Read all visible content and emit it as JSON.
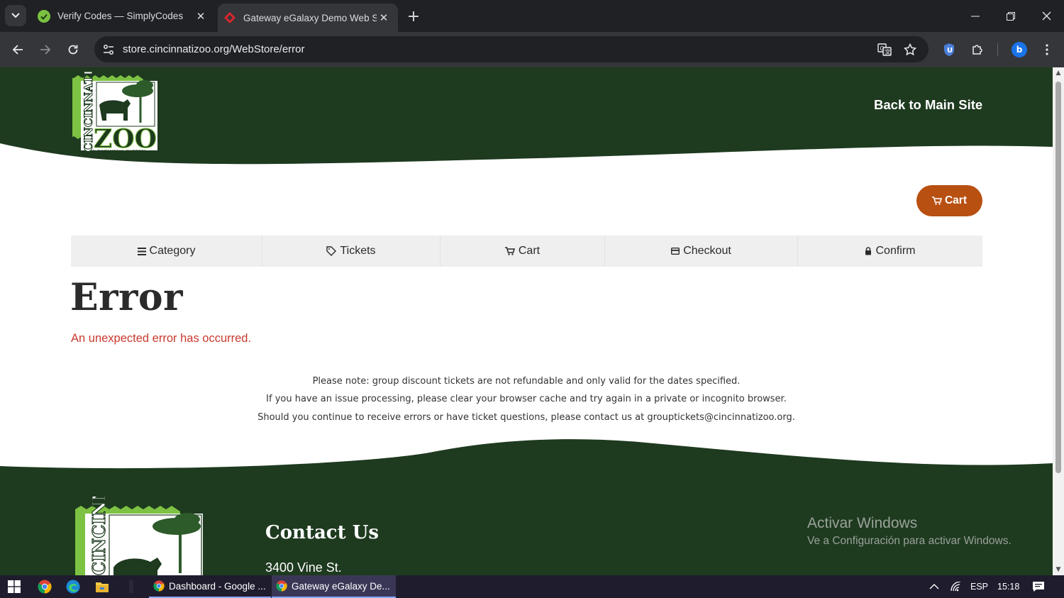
{
  "browser": {
    "tabs": [
      {
        "title": "Verify Codes — SimplyCodes",
        "active": false
      },
      {
        "title": "Gateway eGalaxy Demo Web St",
        "active": true
      }
    ],
    "url": "store.cincinnatizoo.org/WebStore/error",
    "profile_initial": "b",
    "colors": {
      "frame": "#202124",
      "toolbar": "#35363a"
    }
  },
  "header": {
    "back_link": "Back to Main Site",
    "logo_text": "CINCINNATI ZOO & BOTANICAL GARDEN"
  },
  "cart_button": {
    "label": "Cart",
    "icon": "cart-icon"
  },
  "steps": [
    {
      "label": "Category",
      "icon": "list-icon"
    },
    {
      "label": "Tickets",
      "icon": "tag-icon"
    },
    {
      "label": "Cart",
      "icon": "cart-icon"
    },
    {
      "label": "Checkout",
      "icon": "credit-card-icon"
    },
    {
      "label": "Confirm",
      "icon": "lock-icon"
    }
  ],
  "page": {
    "title": "Error",
    "error_message": "An unexpected error has occurred.",
    "notes": [
      "Please note: group discount tickets are not refundable and only valid for the dates specified.",
      "If you have an issue processing, please clear your browser cache and try again in a private or incognito browser.",
      "Should you continue to receive errors or have ticket questions, please contact us at grouptickets@cincinnatizoo.org."
    ]
  },
  "footer": {
    "contact_title": "Contact Us",
    "address": "3400 Vine St."
  },
  "watermark": {
    "line1": "Activar Windows",
    "line2": "Ve a Configuración para activar Windows."
  },
  "taskbar": {
    "apps": [
      {
        "label": "Dashboard - Google ..."
      },
      {
        "label": "Gateway eGalaxy De..."
      }
    ],
    "language": "ESP",
    "time": "15:18"
  },
  "colors": {
    "zoo_green": "#1e3a1f",
    "accent_orange": "#b85012",
    "error_red": "#c93a2e",
    "logo_lime": "#7dc242"
  }
}
